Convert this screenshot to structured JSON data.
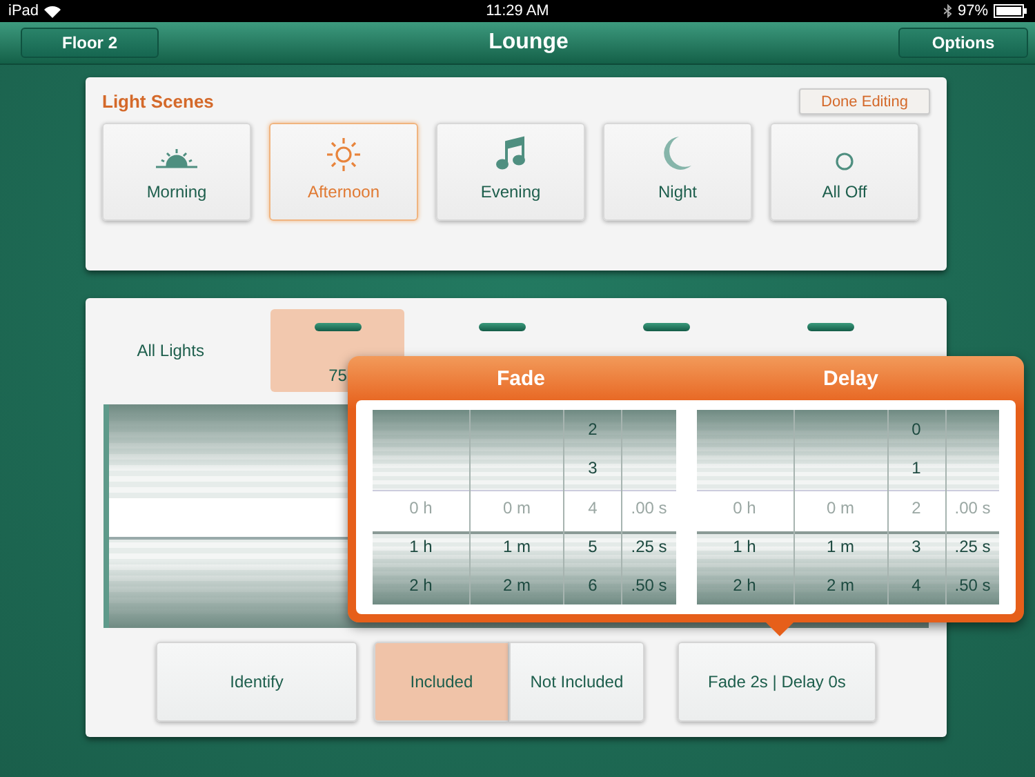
{
  "status_bar": {
    "carrier": "iPad",
    "time": "11:29 AM",
    "battery": "97%"
  },
  "nav_bar": {
    "left_button": "Floor 2",
    "title": "Lounge",
    "right_button": "Options"
  },
  "scenes": {
    "title": "Light Scenes",
    "edit_button": "Done Editing",
    "items": [
      {
        "label": "Morning",
        "kind": "sunrise",
        "selected": false
      },
      {
        "label": "Afternoon",
        "kind": "sun",
        "selected": true
      },
      {
        "label": "Evening",
        "kind": "music",
        "selected": false
      },
      {
        "label": "Night",
        "kind": "moon",
        "selected": false
      },
      {
        "label": "All Off",
        "kind": "off",
        "selected": false
      }
    ]
  },
  "lights": {
    "tabs": [
      {
        "lines": [
          "All Lights"
        ],
        "kind": "all",
        "selected": false
      },
      {
        "lines": [
          "75"
        ],
        "kind": "light",
        "selected": true
      },
      {
        "kind": "light",
        "selected": false
      },
      {
        "kind": "light",
        "selected": false
      },
      {
        "kind": "light",
        "selected": false
      }
    ],
    "actions": {
      "identify": "Identify",
      "segments": [
        {
          "label": "Included",
          "selected": true
        },
        {
          "label": "Not Included",
          "selected": false
        }
      ],
      "timing": "Fade 2s | Delay 0s"
    }
  },
  "popover": {
    "pickers": [
      {
        "title": "Fade",
        "columns": [
          {
            "selected": "0 h",
            "below": [
              "1 h",
              "2 h"
            ]
          },
          {
            "selected": "0 m",
            "below": [
              "1 m",
              "2 m"
            ]
          },
          {
            "above": [
              "2",
              "3"
            ],
            "selected": "4",
            "below": [
              "5",
              "6"
            ]
          },
          {
            "selected": ".00 s",
            "below": [
              ".25 s",
              ".50 s"
            ]
          }
        ]
      },
      {
        "title": "Delay",
        "columns": [
          {
            "selected": "0 h",
            "below": [
              "1 h",
              "2 h"
            ]
          },
          {
            "selected": "0 m",
            "below": [
              "1 m",
              "2 m"
            ]
          },
          {
            "above": [
              "0",
              "1"
            ],
            "selected": "2",
            "below": [
              "3",
              "4"
            ]
          },
          {
            "selected": ".00 s",
            "below": [
              ".25 s",
              ".50 s"
            ]
          }
        ]
      }
    ]
  }
}
